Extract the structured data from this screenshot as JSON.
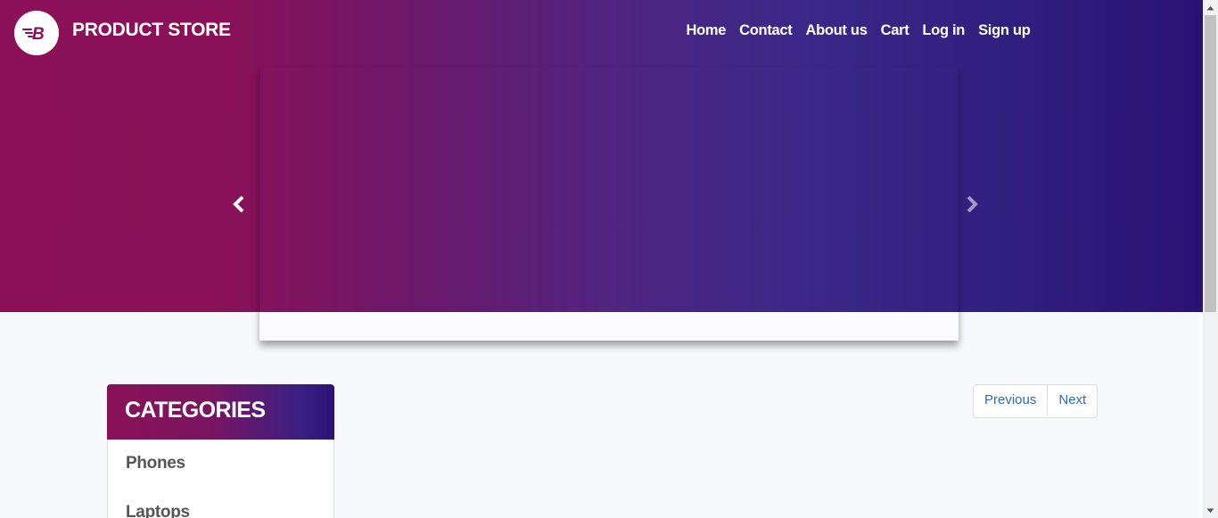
{
  "brand": {
    "name": "PRODUCT STORE",
    "logo_icon": "brand-b-logo-icon"
  },
  "nav": {
    "links": [
      "Home",
      "Contact",
      "About us",
      "Cart",
      "Log in",
      "Sign up"
    ]
  },
  "carousel": {
    "prev_icon": "chevron-left-icon",
    "next_icon": "chevron-right-icon"
  },
  "categories": {
    "title": "CATEGORIES",
    "items": [
      "Phones",
      "Laptops"
    ]
  },
  "pagination": {
    "previous_label": "Previous",
    "next_label": "Next"
  },
  "colors": {
    "gradient_start": "#8c1158",
    "gradient_end": "#2a1273",
    "link": "#2b6cb0",
    "background": "#f8f9fc"
  }
}
